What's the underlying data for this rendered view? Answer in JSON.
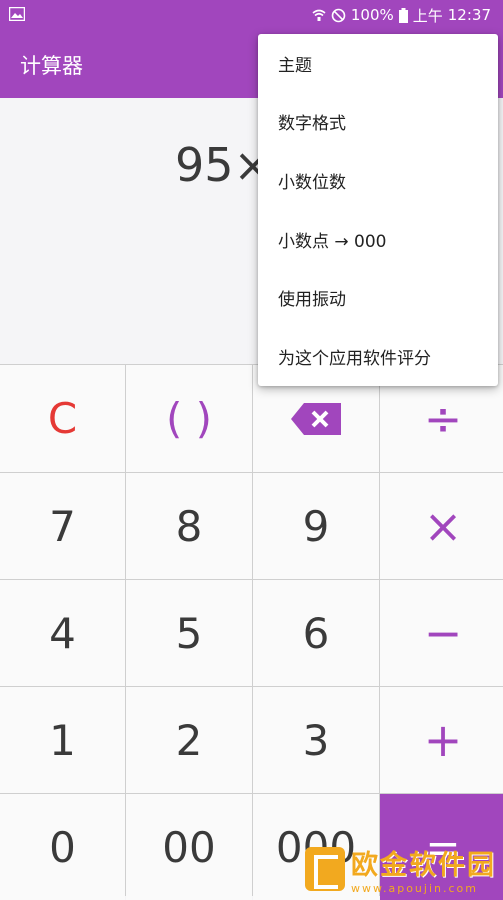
{
  "status_bar": {
    "battery_percent": "100%",
    "period": "上午",
    "time": "12:37"
  },
  "app_bar": {
    "title": "计算器"
  },
  "display": {
    "expression": "95×"
  },
  "menu": {
    "items": [
      "主题",
      "数字格式",
      "小数位数",
      "小数点 → 000",
      "使用振动",
      "为这个应用软件评分"
    ]
  },
  "keypad": {
    "keys": [
      [
        "C",
        "( )",
        "",
        "÷"
      ],
      [
        "7",
        "8",
        "9",
        "×"
      ],
      [
        "4",
        "5",
        "6",
        "−"
      ],
      [
        "1",
        "2",
        "3",
        "+"
      ],
      [
        "0",
        "00",
        "000",
        "="
      ]
    ]
  },
  "watermark": {
    "title": "欧金软件园",
    "url": "www.apoujin.com"
  },
  "colors": {
    "accent": "#a146bd",
    "clear": "#e53935",
    "watermark": "#f2a91f"
  }
}
